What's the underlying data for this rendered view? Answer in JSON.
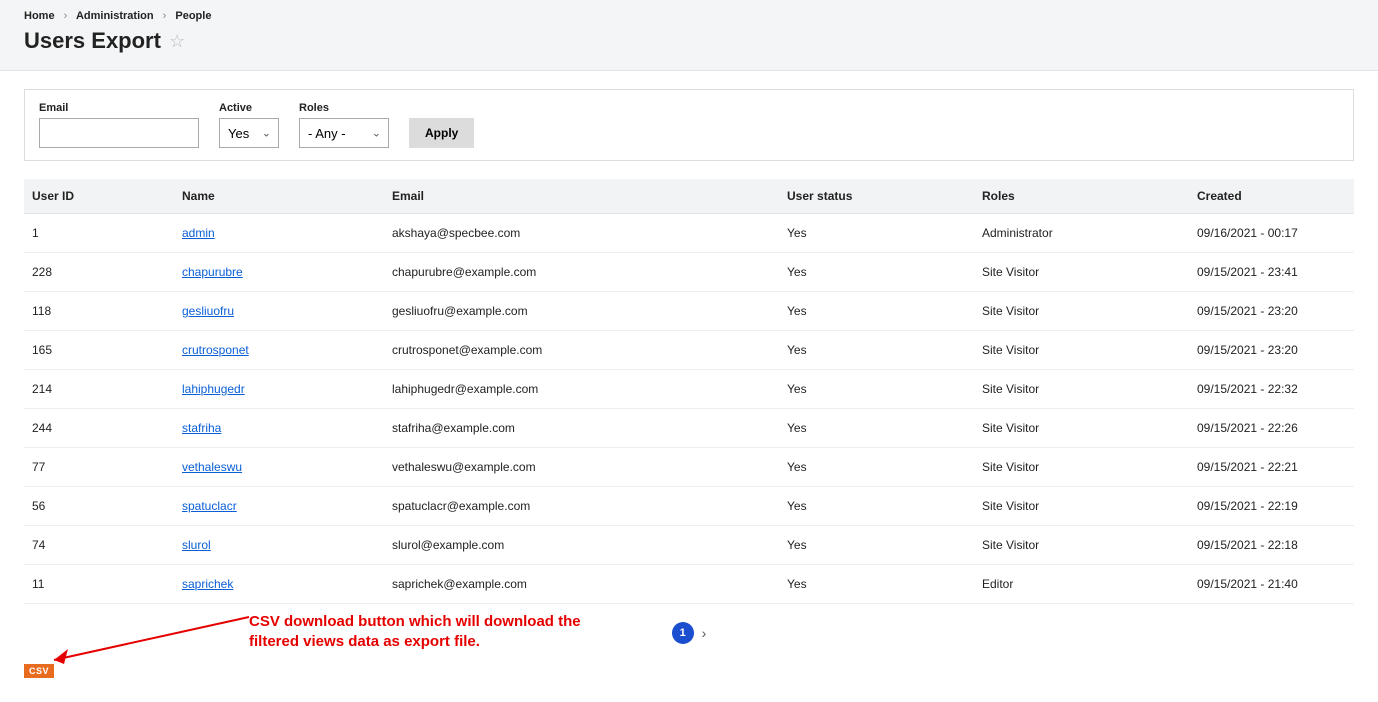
{
  "breadcrumb": {
    "home": "Home",
    "admin": "Administration",
    "people": "People"
  },
  "page": {
    "title": "Users Export"
  },
  "filters": {
    "email_label": "Email",
    "email_value": "",
    "active_label": "Active",
    "active_value": "Yes",
    "roles_label": "Roles",
    "roles_value": "- Any -",
    "apply_label": "Apply"
  },
  "table": {
    "headers": {
      "user_id": "User ID",
      "name": "Name",
      "email": "Email",
      "status": "User status",
      "roles": "Roles",
      "created": "Created"
    },
    "rows": [
      {
        "id": "1",
        "name": "admin",
        "email": "akshaya@specbee.com",
        "status": "Yes",
        "roles": "Administrator",
        "created": "09/16/2021 - 00:17"
      },
      {
        "id": "228",
        "name": "chapurubre",
        "email": "chapurubre@example.com",
        "status": "Yes",
        "roles": "Site Visitor",
        "created": "09/15/2021 - 23:41"
      },
      {
        "id": "118",
        "name": "gesliuofru",
        "email": "gesliuofru@example.com",
        "status": "Yes",
        "roles": "Site Visitor",
        "created": "09/15/2021 - 23:20"
      },
      {
        "id": "165",
        "name": "crutrosponet",
        "email": "crutrosponet@example.com",
        "status": "Yes",
        "roles": "Site Visitor",
        "created": "09/15/2021 - 23:20"
      },
      {
        "id": "214",
        "name": "lahiphugedr",
        "email": "lahiphugedr@example.com",
        "status": "Yes",
        "roles": "Site Visitor",
        "created": "09/15/2021 - 22:32"
      },
      {
        "id": "244",
        "name": "stafriha",
        "email": "stafriha@example.com",
        "status": "Yes",
        "roles": "Site Visitor",
        "created": "09/15/2021 - 22:26"
      },
      {
        "id": "77",
        "name": "vethaleswu",
        "email": "vethaleswu@example.com",
        "status": "Yes",
        "roles": "Site Visitor",
        "created": "09/15/2021 - 22:21"
      },
      {
        "id": "56",
        "name": "spatuclacr",
        "email": "spatuclacr@example.com",
        "status": "Yes",
        "roles": "Site Visitor",
        "created": "09/15/2021 - 22:19"
      },
      {
        "id": "74",
        "name": "slurol",
        "email": "slurol@example.com",
        "status": "Yes",
        "roles": "Site Visitor",
        "created": "09/15/2021 - 22:18"
      },
      {
        "id": "11",
        "name": "saprichek",
        "email": "saprichek@example.com",
        "status": "Yes",
        "roles": "Editor",
        "created": "09/15/2021 - 21:40"
      }
    ]
  },
  "pagination": {
    "current": "1"
  },
  "csv": {
    "label": "CSV"
  },
  "annotation": {
    "line1": "CSV download button which will download the",
    "line2": "filtered views data as export file."
  }
}
